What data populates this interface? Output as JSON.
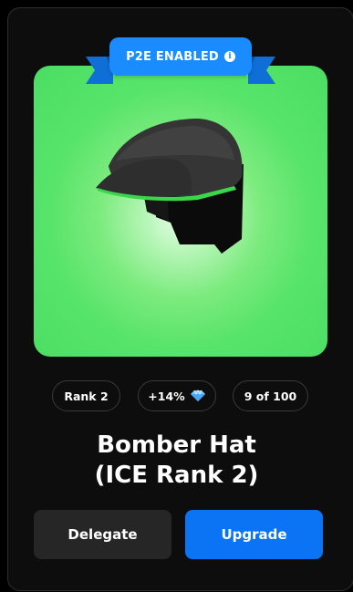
{
  "badge": {
    "label": "P2E ENABLED",
    "info_icon": "info-icon",
    "color": "#1a8cff"
  },
  "item": {
    "image_subject": "black flat cap with green trim",
    "background_color": "#4ade63"
  },
  "stats": {
    "rank": "Rank 2",
    "bonus": "+14%",
    "bonus_icon": "diamond-icon",
    "supply": "9 of 100"
  },
  "title": {
    "line1": "Bomber Hat",
    "line2": "(ICE Rank 2)"
  },
  "actions": {
    "delegate_label": "Delegate",
    "upgrade_label": "Upgrade",
    "upgrade_color": "#0a74f5"
  }
}
